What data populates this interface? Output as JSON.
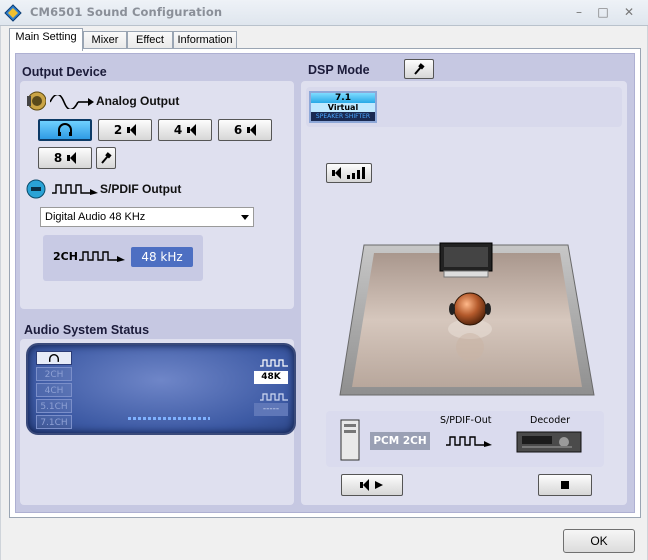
{
  "window": {
    "title": "CM6501 Sound Configuration"
  },
  "tabs": [
    {
      "label": "Main Setting",
      "active": true
    },
    {
      "label": "Mixer",
      "active": false
    },
    {
      "label": "Effect",
      "active": false
    },
    {
      "label": "Information",
      "active": false
    }
  ],
  "output_device": {
    "heading": "Output Device",
    "analog_label": "Analog Output",
    "channel_buttons": [
      {
        "label": "",
        "icon": "headphone-icon",
        "selected": true
      },
      {
        "label": "2",
        "icon": "speaker-icon",
        "selected": false
      },
      {
        "label": "4",
        "icon": "speaker-icon",
        "selected": false
      },
      {
        "label": "6",
        "icon": "speaker-icon",
        "selected": false
      },
      {
        "label": "8",
        "icon": "speaker-icon",
        "selected": false
      }
    ],
    "spdif_label": "S/PDIF Output",
    "spdif_format": "Digital Audio 48 KHz",
    "rate_channels": "2CH",
    "rate_value": "48 kHz"
  },
  "audio_status": {
    "heading": "Audio System Status",
    "channels": [
      "",
      "2CH",
      "4CH",
      "5.1CH",
      "7.1CH"
    ],
    "rate_display": "48K",
    "input_display": "-----"
  },
  "dsp": {
    "heading": "DSP Mode",
    "badge_top": "7.1",
    "badge_middle": "Virtual",
    "badge_bottom": "SPEAKER SHIFTER",
    "signal_pcm": "PCM 2CH",
    "spdif_out_label": "S/PDIF-Out",
    "decoder_label": "Decoder"
  },
  "footer": {
    "ok_label": "OK"
  },
  "colors": {
    "panel": "#c6c8e2",
    "accent": "#4d6fc2",
    "selected": "#2f9be4"
  }
}
